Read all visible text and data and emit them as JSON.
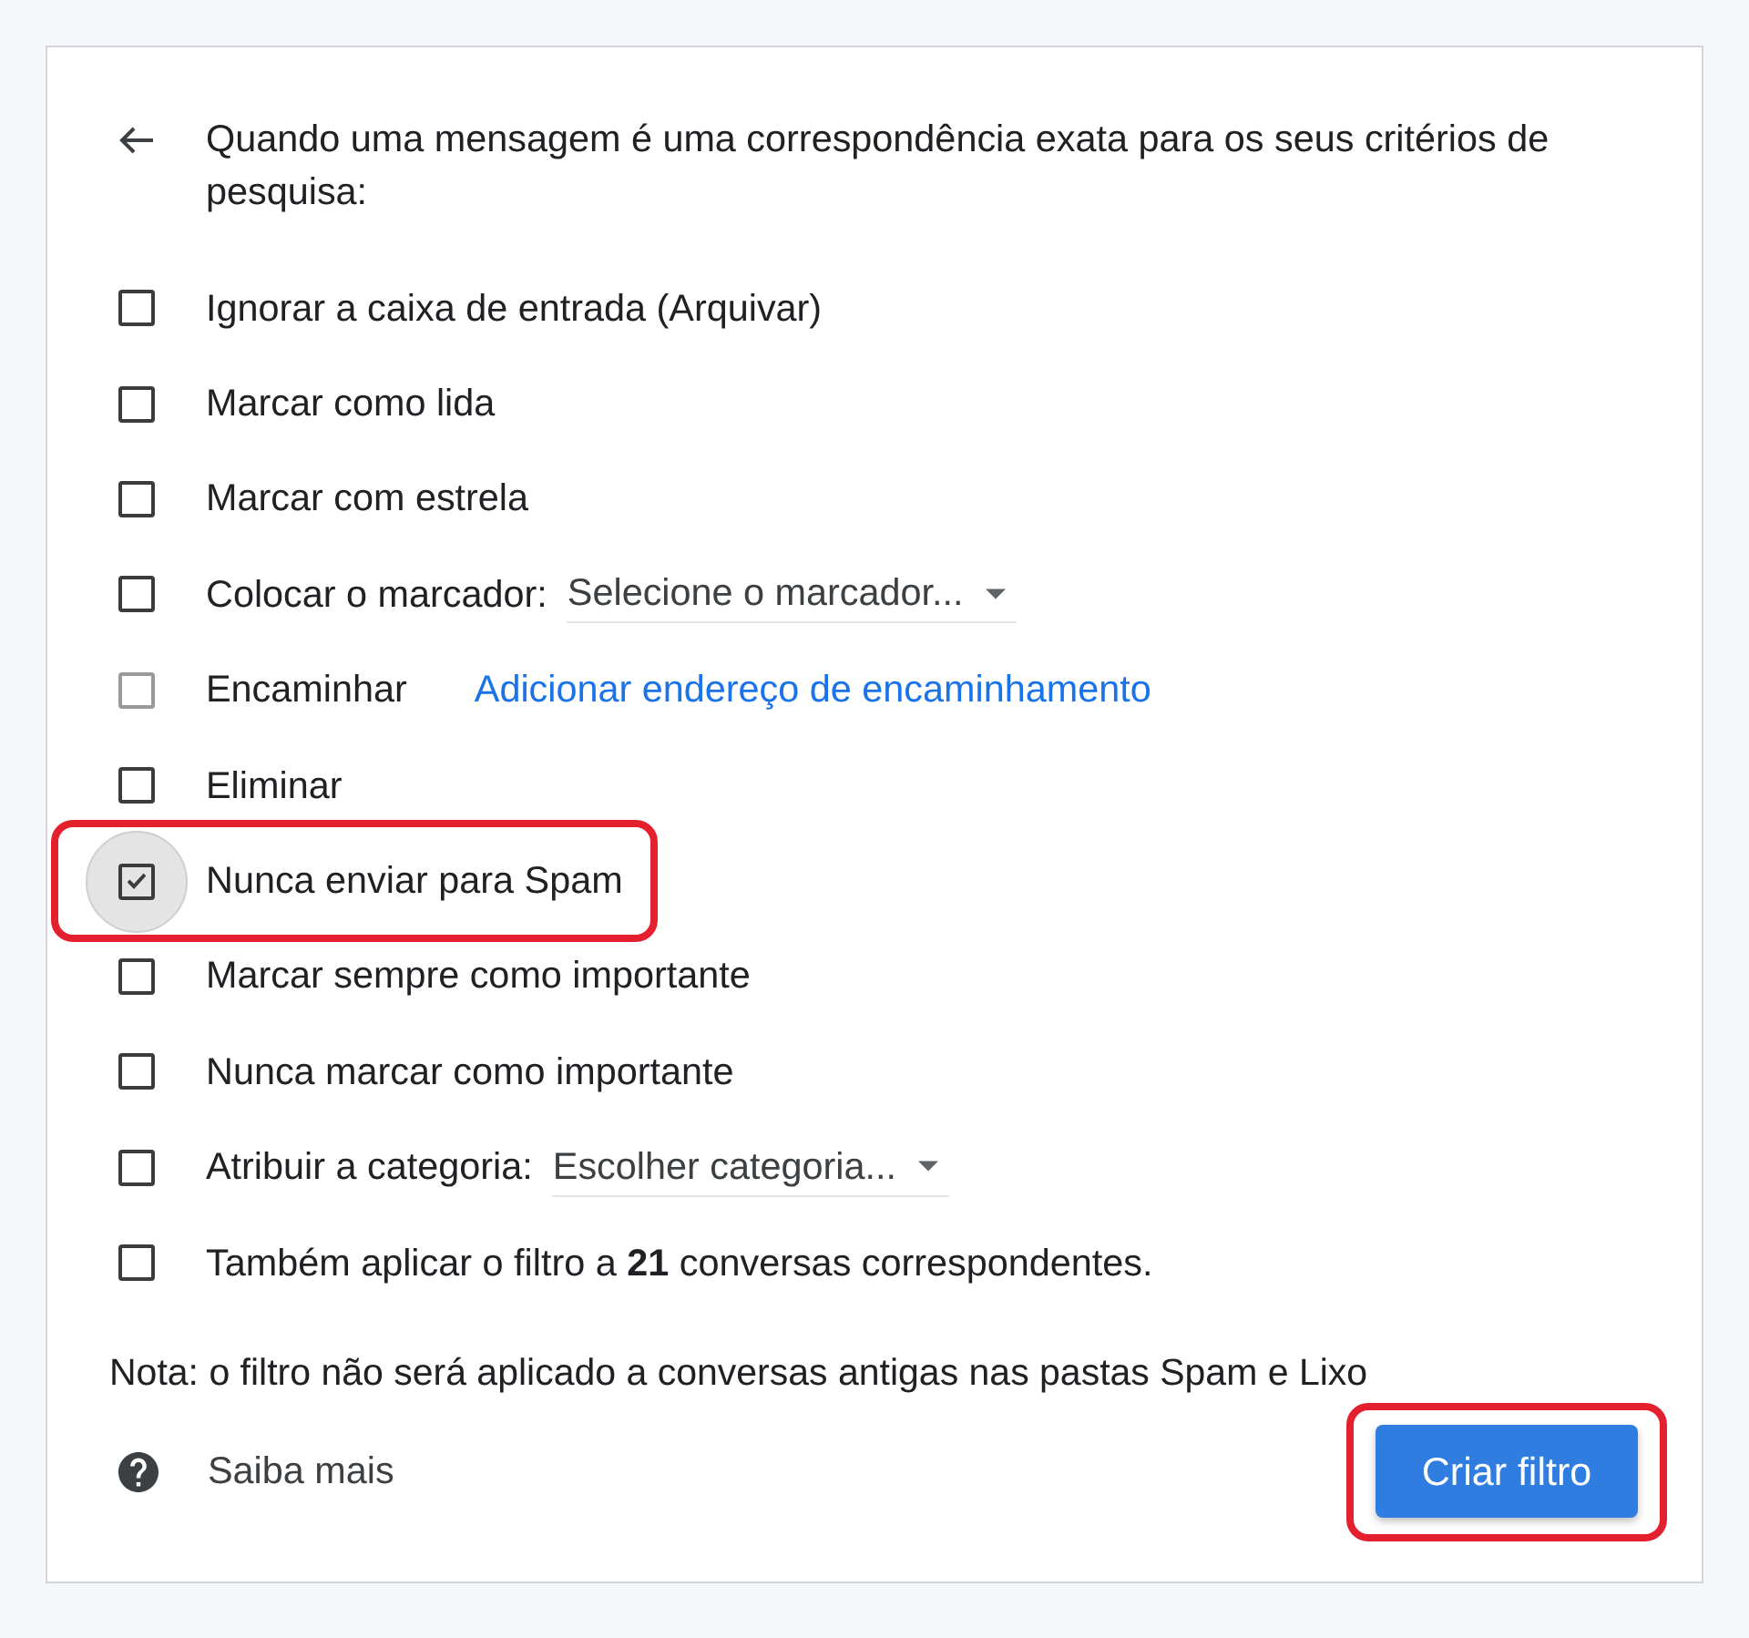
{
  "header": {
    "text": "Quando uma mensagem é uma correspondência exata para os seus critérios de pesquisa:"
  },
  "options": [
    {
      "kind": "plain",
      "label": "Ignorar a caixa de entrada (Arquivar)",
      "checked": false,
      "disabled": false,
      "focused": false,
      "highlighted": false
    },
    {
      "kind": "plain",
      "label": "Marcar como lida",
      "checked": false,
      "disabled": false,
      "focused": false,
      "highlighted": false
    },
    {
      "kind": "plain",
      "label": "Marcar com estrela",
      "checked": false,
      "disabled": false,
      "focused": false,
      "highlighted": false
    },
    {
      "kind": "dropdown",
      "label": "Colocar o marcador:",
      "placeholder": "Selecione o marcador...",
      "checked": false,
      "disabled": false,
      "focused": false,
      "highlighted": false
    },
    {
      "kind": "link",
      "label": "Encaminhar",
      "link": "Adicionar endereço de encaminhamento",
      "checked": false,
      "disabled": true,
      "focused": false,
      "highlighted": false
    },
    {
      "kind": "plain",
      "label": "Eliminar",
      "checked": false,
      "disabled": false,
      "focused": false,
      "highlighted": false
    },
    {
      "kind": "plain",
      "label": "Nunca enviar para Spam",
      "checked": true,
      "disabled": false,
      "focused": true,
      "highlighted": true
    },
    {
      "kind": "plain",
      "label": "Marcar sempre como importante",
      "checked": false,
      "disabled": false,
      "focused": false,
      "highlighted": false
    },
    {
      "kind": "plain",
      "label": "Nunca marcar como importante",
      "checked": false,
      "disabled": false,
      "focused": false,
      "highlighted": false
    },
    {
      "kind": "dropdown",
      "label": "Atribuir a categoria:",
      "placeholder": "Escolher categoria...",
      "checked": false,
      "disabled": false,
      "focused": false,
      "highlighted": false
    },
    {
      "kind": "plain",
      "label": "Também aplicar o filtro a **21** conversas correspondentes.",
      "checked": false,
      "disabled": false,
      "focused": false,
      "highlighted": false
    }
  ],
  "note": "Nota: o filtro não será aplicado a conversas antigas nas pastas Spam e Lixo",
  "help": {
    "label": "Saiba mais"
  },
  "create_button": {
    "label": "Criar filtro",
    "highlighted": true
  }
}
